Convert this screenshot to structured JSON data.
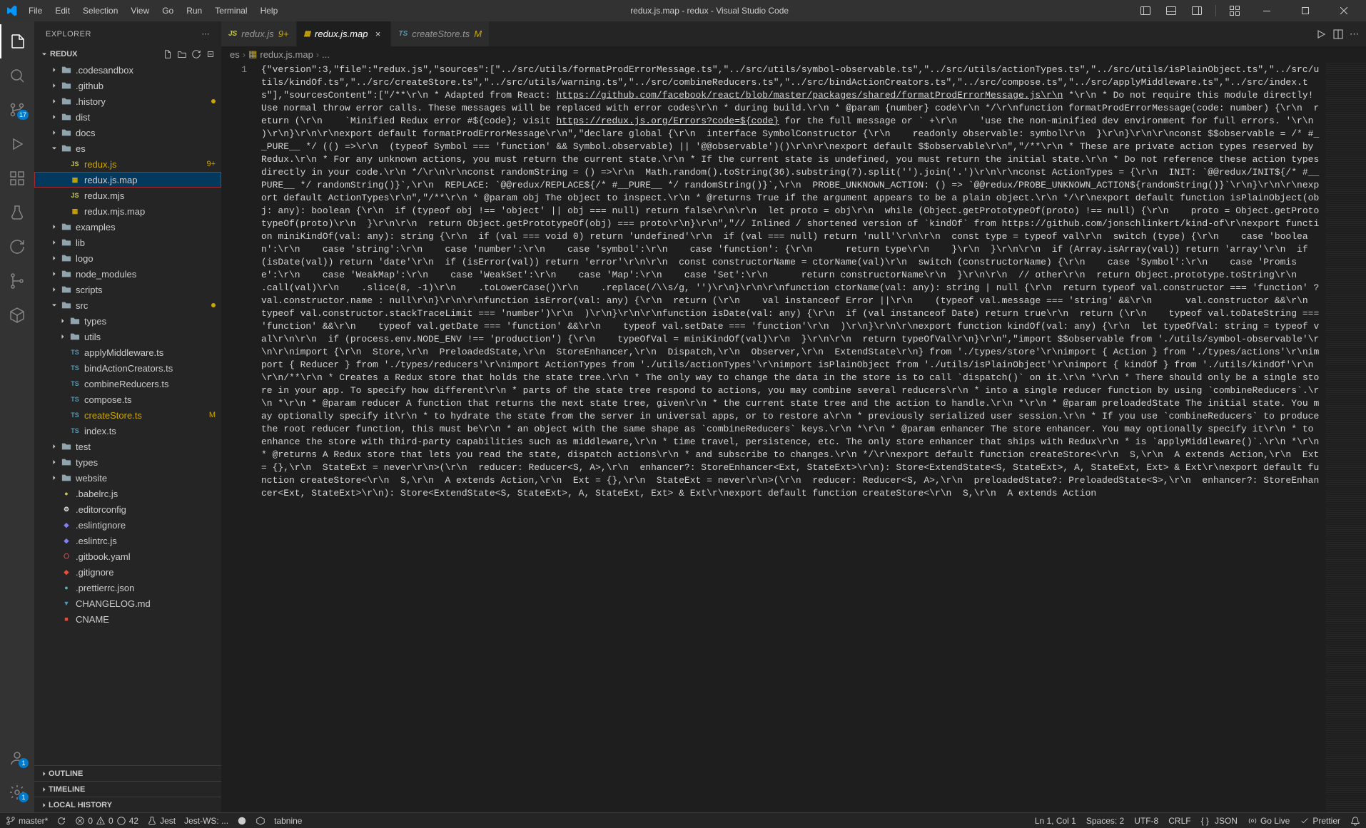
{
  "title": "redux.js.map - redux - Visual Studio Code",
  "menu": [
    "File",
    "Edit",
    "Selection",
    "View",
    "Go",
    "Run",
    "Terminal",
    "Help"
  ],
  "activity": {
    "scm_badge": "17",
    "accounts_badge": "1",
    "settings_badge": "1"
  },
  "explorer": {
    "title": "EXPLORER",
    "root": "REDUX",
    "outline": "OUTLINE",
    "timeline": "TIMELINE",
    "localHistory": "LOCAL HISTORY",
    "tree": [
      {
        "label": ".codesandbox",
        "type": "folder",
        "indent": 1,
        "chev": "right"
      },
      {
        "label": ".github",
        "type": "folder",
        "indent": 1,
        "chev": "right"
      },
      {
        "label": ".history",
        "type": "folder",
        "indent": 1,
        "chev": "right",
        "mod": "dot"
      },
      {
        "label": "dist",
        "type": "folder",
        "indent": 1,
        "chev": "right"
      },
      {
        "label": "docs",
        "type": "folder",
        "indent": 1,
        "chev": "right"
      },
      {
        "label": "es",
        "type": "folder",
        "indent": 1,
        "chev": "down"
      },
      {
        "label": "redux.js",
        "type": "file",
        "indent": 2,
        "icon": "js",
        "badge": "9+",
        "modcolor": true
      },
      {
        "label": "redux.js.map",
        "type": "file",
        "indent": 2,
        "icon": "map",
        "selected": true,
        "highlighted": true
      },
      {
        "label": "redux.mjs",
        "type": "file",
        "indent": 2,
        "icon": "js"
      },
      {
        "label": "redux.mjs.map",
        "type": "file",
        "indent": 2,
        "icon": "map"
      },
      {
        "label": "examples",
        "type": "folder",
        "indent": 1,
        "chev": "right"
      },
      {
        "label": "lib",
        "type": "folder",
        "indent": 1,
        "chev": "right"
      },
      {
        "label": "logo",
        "type": "folder",
        "indent": 1,
        "chev": "right"
      },
      {
        "label": "node_modules",
        "type": "folder",
        "indent": 1,
        "chev": "right"
      },
      {
        "label": "scripts",
        "type": "folder",
        "indent": 1,
        "chev": "right"
      },
      {
        "label": "src",
        "type": "folder",
        "indent": 1,
        "chev": "down",
        "mod": "dot"
      },
      {
        "label": "types",
        "type": "folder",
        "indent": 2,
        "chev": "right"
      },
      {
        "label": "utils",
        "type": "folder",
        "indent": 2,
        "chev": "right"
      },
      {
        "label": "applyMiddleware.ts",
        "type": "file",
        "indent": 2,
        "icon": "ts"
      },
      {
        "label": "bindActionCreators.ts",
        "type": "file",
        "indent": 2,
        "icon": "ts"
      },
      {
        "label": "combineReducers.ts",
        "type": "file",
        "indent": 2,
        "icon": "ts"
      },
      {
        "label": "compose.ts",
        "type": "file",
        "indent": 2,
        "icon": "ts"
      },
      {
        "label": "createStore.ts",
        "type": "file",
        "indent": 2,
        "icon": "ts",
        "mod": "M",
        "modcolor": true
      },
      {
        "label": "index.ts",
        "type": "file",
        "indent": 2,
        "icon": "ts"
      },
      {
        "label": "test",
        "type": "folder",
        "indent": 1,
        "chev": "right"
      },
      {
        "label": "types",
        "type": "folder",
        "indent": 1,
        "chev": "right"
      },
      {
        "label": "website",
        "type": "folder",
        "indent": 1,
        "chev": "right"
      },
      {
        "label": ".babelrc.js",
        "type": "file",
        "indent": 1,
        "icon": "babel"
      },
      {
        "label": ".editorconfig",
        "type": "file",
        "indent": 1,
        "icon": "editorconfig"
      },
      {
        "label": ".eslintignore",
        "type": "file",
        "indent": 1,
        "icon": "eslint"
      },
      {
        "label": ".eslintrc.js",
        "type": "file",
        "indent": 1,
        "icon": "eslint"
      },
      {
        "label": ".gitbook.yaml",
        "type": "file",
        "indent": 1,
        "icon": "yaml"
      },
      {
        "label": ".gitignore",
        "type": "file",
        "indent": 1,
        "icon": "git"
      },
      {
        "label": ".prettierrc.json",
        "type": "file",
        "indent": 1,
        "icon": "prettier"
      },
      {
        "label": "CHANGELOG.md",
        "type": "file",
        "indent": 1,
        "icon": "md"
      },
      {
        "label": "CNAME",
        "type": "file",
        "indent": 1,
        "icon": "text"
      }
    ]
  },
  "tabs": [
    {
      "label": "redux.js",
      "badge": "9+",
      "icon": "js"
    },
    {
      "label": "redux.js.map",
      "active": true,
      "close": true,
      "icon": "map"
    },
    {
      "label": "createStore.ts",
      "mod": "M",
      "icon": "ts"
    }
  ],
  "breadcrumbs": {
    "segments": [
      "es",
      "redux.js.map",
      "..."
    ],
    "icon_before_1": "map"
  },
  "editor": {
    "line_number": "1",
    "content_pre": "{\"version\":3,\"file\":\"redux.js\",\"sources\":[\"../src/utils/formatProdErrorMessage.ts\",\"../src/utils/symbol-observable.ts\",\"../src/utils/actionTypes.ts\",\"../src/utils/isPlainObject.ts\",\"../src/utils/kindOf.ts\",\"../src/createStore.ts\",\"../src/utils/warning.ts\",\"../src/combineReducers.ts\",\"../src/bindActionCreators.ts\",\"../src/compose.ts\",\"../src/applyMiddleware.ts\",\"../src/index.ts\"],\"sourcesContent\":[\"/**\\r\\n * Adapted from React: ",
    "link1": "https://github.com/facebook/react/blob/master/packages/shared/formatProdErrorMessage.js\\r\\n",
    "content_mid1": " *\\r\\n * Do not require this module directly! Use normal throw error calls. These messages will be replaced with error codes\\r\\n * during build.\\r\\n * @param {number} code\\r\\n */\\r\\nfunction formatProdErrorMessage(code: number) {\\r\\n  return (\\r\\n    `Minified Redux error #${code}; visit ",
    "link2": "https://redux.js.org/Errors?code=${code}",
    "content_post": " for the full message or ` +\\r\\n    'use the non-minified dev environment for full errors. '\\r\\n  )\\r\\n}\\r\\n\\r\\nexport default formatProdErrorMessage\\r\\n\",\"declare global {\\r\\n  interface SymbolConstructor {\\r\\n    readonly observable: symbol\\r\\n  }\\r\\n}\\r\\n\\r\\nconst $$observable = /* #__PURE__ */ (() =>\\r\\n  (typeof Symbol === 'function' && Symbol.observable) || '@@observable')()\\r\\n\\r\\nexport default $$observable\\r\\n\",\"/**\\r\\n * These are private action types reserved by Redux.\\r\\n * For any unknown actions, you must return the current state.\\r\\n * If the current state is undefined, you must return the initial state.\\r\\n * Do not reference these action types directly in your code.\\r\\n */\\r\\n\\r\\nconst randomString = () =>\\r\\n  Math.random().toString(36).substring(7).split('').join('.')\\r\\n\\r\\nconst ActionTypes = {\\r\\n  INIT: `@@redux/INIT${/* #__PURE__ */ randomString()}`,\\r\\n  REPLACE: `@@redux/REPLACE${/* #__PURE__ */ randomString()}`,\\r\\n  PROBE_UNKNOWN_ACTION: () => `@@redux/PROBE_UNKNOWN_ACTION${randomString()}`\\r\\n}\\r\\n\\r\\nexport default ActionTypes\\r\\n\",\"/**\\r\\n * @param obj The object to inspect.\\r\\n * @returns True if the argument appears to be a plain object.\\r\\n */\\r\\nexport default function isPlainObject(obj: any): boolean {\\r\\n  if (typeof obj !== 'object' || obj === null) return false\\r\\n\\r\\n  let proto = obj\\r\\n  while (Object.getPrototypeOf(proto) !== null) {\\r\\n    proto = Object.getPrototypeOf(proto)\\r\\n  }\\r\\n\\r\\n  return Object.getPrototypeOf(obj) === proto\\r\\n}\\r\\n\",\"// Inlined / shortened version of `kindOf` from https://github.com/jonschlinkert/kind-of\\r\\nexport function miniKindOf(val: any): string {\\r\\n  if (val === void 0) return 'undefined'\\r\\n  if (val === null) return 'null'\\r\\n\\r\\n  const type = typeof val\\r\\n  switch (type) {\\r\\n    case 'boolean':\\r\\n    case 'string':\\r\\n    case 'number':\\r\\n    case 'symbol':\\r\\n    case 'function': {\\r\\n      return type\\r\\n    }\\r\\n  }\\r\\n\\r\\n  if (Array.isArray(val)) return 'array'\\r\\n  if (isDate(val)) return 'date'\\r\\n  if (isError(val)) return 'error'\\r\\n\\r\\n  const constructorName = ctorName(val)\\r\\n  switch (constructorName) {\\r\\n    case 'Symbol':\\r\\n    case 'Promise':\\r\\n    case 'WeakMap':\\r\\n    case 'WeakSet':\\r\\n    case 'Map':\\r\\n    case 'Set':\\r\\n      return constructorName\\r\\n  }\\r\\n\\r\\n  // other\\r\\n  return Object.prototype.toString\\r\\n    .call(val)\\r\\n    .slice(8, -1)\\r\\n    .toLowerCase()\\r\\n    .replace(/\\\\s/g, '')\\r\\n}\\r\\n\\r\\nfunction ctorName(val: any): string | null {\\r\\n  return typeof val.constructor === 'function' ? val.constructor.name : null\\r\\n}\\r\\n\\r\\nfunction isError(val: any) {\\r\\n  return (\\r\\n    val instanceof Error ||\\r\\n    (typeof val.message === 'string' &&\\r\\n      val.constructor &&\\r\\n      typeof val.constructor.stackTraceLimit === 'number')\\r\\n  )\\r\\n}\\r\\n\\r\\nfunction isDate(val: any) {\\r\\n  if (val instanceof Date) return true\\r\\n  return (\\r\\n    typeof val.toDateString === 'function' &&\\r\\n    typeof val.getDate === 'function' &&\\r\\n    typeof val.setDate === 'function'\\r\\n  )\\r\\n}\\r\\n\\r\\nexport function kindOf(val: any) {\\r\\n  let typeOfVal: string = typeof val\\r\\n\\r\\n  if (process.env.NODE_ENV !== 'production') {\\r\\n    typeOfVal = miniKindOf(val)\\r\\n  }\\r\\n\\r\\n  return typeOfVal\\r\\n}\\r\\n\",\"import $$observable from './utils/symbol-observable'\\r\\n\\r\\nimport {\\r\\n  Store,\\r\\n  PreloadedState,\\r\\n  StoreEnhancer,\\r\\n  Dispatch,\\r\\n  Observer,\\r\\n  ExtendState\\r\\n} from './types/store'\\r\\nimport { Action } from './types/actions'\\r\\nimport { Reducer } from './types/reducers'\\r\\nimport ActionTypes from './utils/actionTypes'\\r\\nimport isPlainObject from './utils/isPlainObject'\\r\\nimport { kindOf } from './utils/kindOf'\\r\\n\\r\\n/**\\r\\n * Creates a Redux store that holds the state tree.\\r\\n * The only way to change the data in the store is to call `dispatch()` on it.\\r\\n *\\r\\n * There should only be a single store in your app. To specify how different\\r\\n * parts of the state tree respond to actions, you may combine several reducers\\r\\n * into a single reducer function by using `combineReducers`.\\r\\n *\\r\\n * @param reducer A function that returns the next state tree, given\\r\\n * the current state tree and the action to handle.\\r\\n *\\r\\n * @param preloadedState The initial state. You may optionally specify it\\r\\n * to hydrate the state from the server in universal apps, or to restore a\\r\\n * previously serialized user session.\\r\\n * If you use `combineReducers` to produce the root reducer function, this must be\\r\\n * an object with the same shape as `combineReducers` keys.\\r\\n *\\r\\n * @param enhancer The store enhancer. You may optionally specify it\\r\\n * to enhance the store with third-party capabilities such as middleware,\\r\\n * time travel, persistence, etc. The only store enhancer that ships with Redux\\r\\n * is `applyMiddleware()`.\\r\\n *\\r\\n * @returns A Redux store that lets you read the state, dispatch actions\\r\\n * and subscribe to changes.\\r\\n */\\r\\nexport default function createStore<\\r\\n  S,\\r\\n  A extends Action,\\r\\n  Ext = {},\\r\\n  StateExt = never\\r\\n>(\\r\\n  reducer: Reducer<S, A>,\\r\\n  enhancer?: StoreEnhancer<Ext, StateExt>\\r\\n): Store<ExtendState<S, StateExt>, A, StateExt, Ext> & Ext\\r\\nexport default function createStore<\\r\\n  S,\\r\\n  A extends Action,\\r\\n  Ext = {},\\r\\n  StateExt = never\\r\\n>(\\r\\n  reducer: Reducer<S, A>,\\r\\n  preloadedState?: PreloadedState<S>,\\r\\n  enhancer?: StoreEnhancer<Ext, StateExt>\\r\\n): Store<ExtendState<S, StateExt>, A, StateExt, Ext> & Ext\\r\\nexport default function createStore<\\r\\n  S,\\r\\n  A extends Action"
  },
  "status": {
    "branch": "master*",
    "sync": "",
    "errors": "0",
    "warnings": "0",
    "lint": "42",
    "jest": "Jest",
    "jestws": "Jest-WS: ...",
    "tabnine": "tabnine",
    "ln_col": "Ln 1, Col 1",
    "spaces": "Spaces: 2",
    "encoding": "UTF-8",
    "eol": "CRLF",
    "language": "JSON",
    "golive": "Go Live",
    "prettier": "Prettier",
    "notif": ""
  }
}
